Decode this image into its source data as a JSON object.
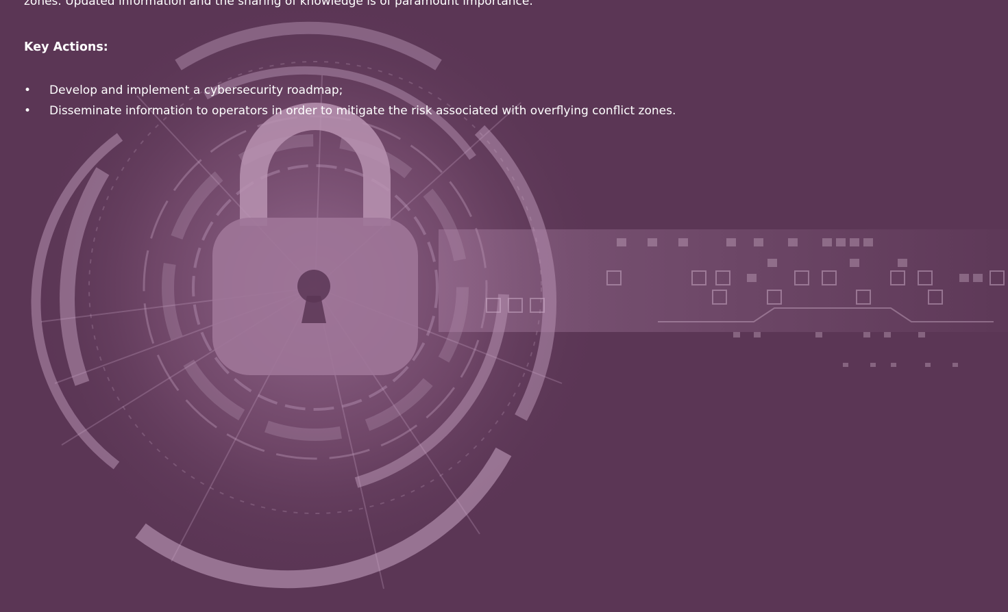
{
  "theme": {
    "background": "#5b3655",
    "art_light": "#c9a6c5",
    "text": "#ffffff"
  },
  "background_art": {
    "icon": "padlock-icon"
  },
  "intro": {
    "text": "zones. Updated information and the sharing of knowledge is of paramount importance."
  },
  "key_actions": {
    "heading": "Key Actions:",
    "bullet": "•",
    "items": [
      "Develop and implement a cybersecurity roadmap;",
      "Disseminate information to operators in order to mitigate the risk associated with overflying conflict zones."
    ]
  }
}
